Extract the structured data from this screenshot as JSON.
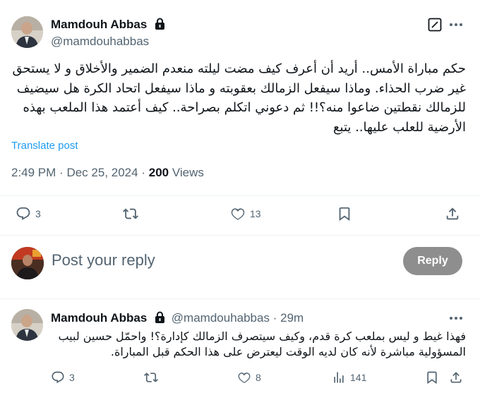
{
  "tweet": {
    "author_name": "Mamdouh Abbas",
    "author_handle": "@mamdouhabbas",
    "text": "حكم مباراة الأمس.. أريد أن أعرف كيف مضت ليلته منعدم الضمير والأخلاق و لا يستحق غير ضرب الحذاء. وماذا سيفعل الزمالك بعقوبته و ماذا سيفعل اتحاد الكرة هل سيضيف للزمالك نقطتين ضاعوا منه؟!! ثم دعوني اتكلم بصراحة.. كيف أعتمد هذا الملعب بهذه الأرضية للعلب عليها.. يتبع",
    "translate_label": "Translate post",
    "time": "2:49 PM",
    "sep": "·",
    "date": "Dec 25, 2024",
    "views_count": "200",
    "views_label": "Views",
    "actions": {
      "replies": "3",
      "reposts": "",
      "likes": "13"
    }
  },
  "reply_box": {
    "placeholder": "Post your reply",
    "button_label": "Reply"
  },
  "reply": {
    "author_name": "Mamdouh Abbas",
    "author_handle": "@mamdouhabbas",
    "sep": "·",
    "time_ago": "29m",
    "text": "فهذا غيط و ليس بملعب كرة قدم، وكيف سيتصرف الزمالك كإدارة؟! واحمّل حسين لبيب المسؤولية مباشرة لأنه كان لديه الوقت ليعترض على هذا الحكم قبل المباراة.",
    "actions": {
      "replies": "3",
      "reposts": "",
      "likes": "8",
      "views": "141"
    }
  },
  "icons": {
    "lock": "lock-icon",
    "grok": "grok-icon",
    "more": "more-icon",
    "reply": "reply-icon",
    "repost": "repost-icon",
    "like": "like-icon",
    "bookmark": "bookmark-icon",
    "share": "share-icon",
    "views": "views-icon"
  },
  "colors": {
    "link": "#1d9bf0",
    "muted": "#536471",
    "text": "#0f1419",
    "reply_button_disabled": "#8e8e8e"
  }
}
